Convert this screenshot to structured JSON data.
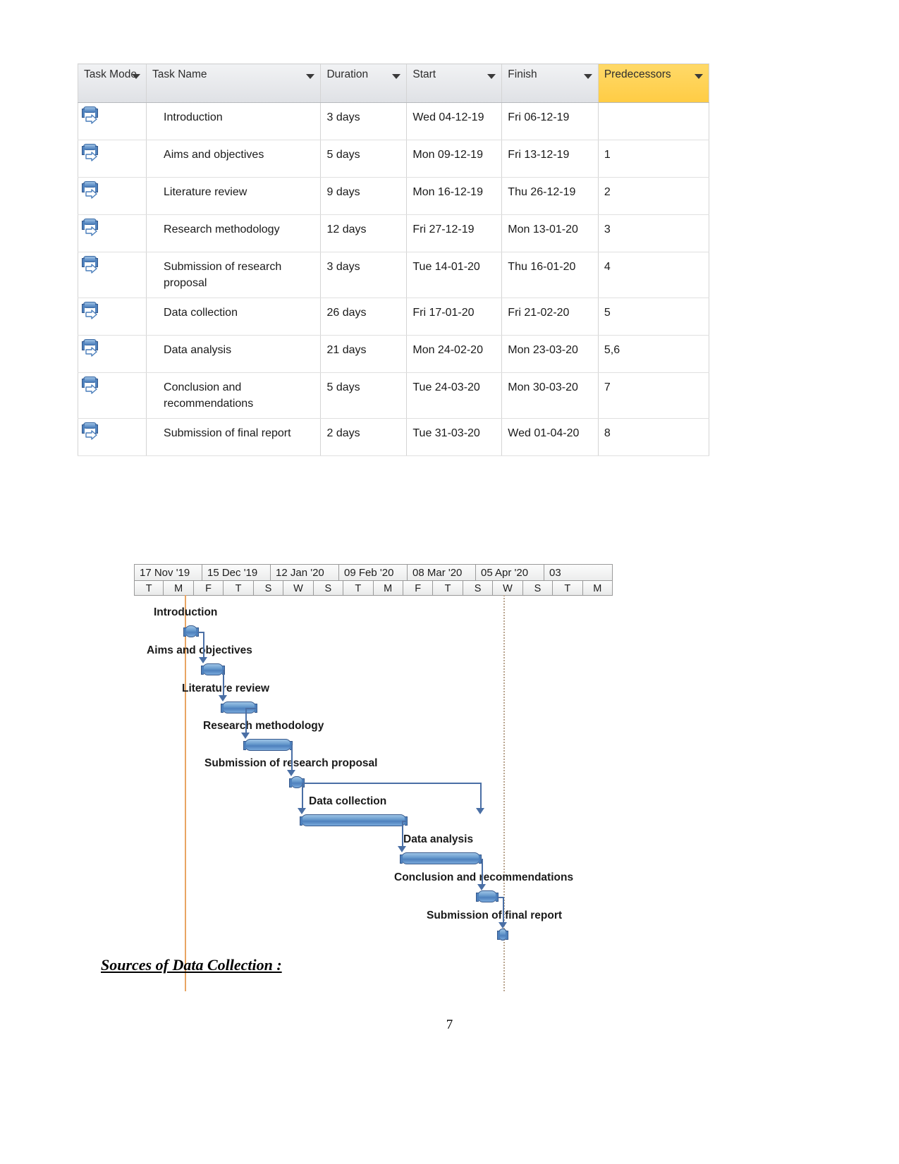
{
  "table": {
    "columns": [
      {
        "key": "mode",
        "label": "Task Mode"
      },
      {
        "key": "name",
        "label": "Task Name"
      },
      {
        "key": "duration",
        "label": "Duration"
      },
      {
        "key": "start",
        "label": "Start"
      },
      {
        "key": "finish",
        "label": "Finish"
      },
      {
        "key": "predecessors",
        "label": "Predecessors"
      }
    ],
    "header_highlight_color": "#ffcc44",
    "rows": [
      {
        "mode_icon": "auto-schedule-icon",
        "name": "Introduction",
        "duration": "3 days",
        "start": "Wed 04-12-19",
        "finish": "Fri 06-12-19",
        "predecessors": ""
      },
      {
        "mode_icon": "auto-schedule-icon",
        "name": "Aims and objectives",
        "duration": "5 days",
        "start": "Mon 09-12-19",
        "finish": "Fri 13-12-19",
        "predecessors": "1"
      },
      {
        "mode_icon": "auto-schedule-icon",
        "name": "Literature review",
        "duration": "9 days",
        "start": "Mon 16-12-19",
        "finish": "Thu 26-12-19",
        "predecessors": "2"
      },
      {
        "mode_icon": "auto-schedule-icon",
        "name": "Research methodology",
        "duration": "12 days",
        "start": "Fri 27-12-19",
        "finish": "Mon 13-01-20",
        "predecessors": "3"
      },
      {
        "mode_icon": "auto-schedule-icon",
        "name": "Submission of research proposal",
        "duration": "3 days",
        "start": "Tue 14-01-20",
        "finish": "Thu 16-01-20",
        "predecessors": "4"
      },
      {
        "mode_icon": "auto-schedule-icon",
        "name": "Data collection",
        "duration": "26 days",
        "start": "Fri 17-01-20",
        "finish": "Fri 21-02-20",
        "predecessors": "5"
      },
      {
        "mode_icon": "auto-schedule-icon",
        "name": "Data analysis",
        "duration": "21 days",
        "start": "Mon 24-02-20",
        "finish": "Mon 23-03-20",
        "predecessors": "5,6"
      },
      {
        "mode_icon": "auto-schedule-icon",
        "name": "Conclusion and recommendations",
        "duration": "5 days",
        "start": "Tue 24-03-20",
        "finish": "Mon 30-03-20",
        "predecessors": "7"
      },
      {
        "mode_icon": "auto-schedule-icon",
        "name": "Submission of final report",
        "duration": "2 days",
        "start": "Tue 31-03-20",
        "finish": "Wed 01-04-20",
        "predecessors": "8"
      }
    ]
  },
  "chart_data": {
    "type": "bar",
    "title": "",
    "xlabel": "",
    "ylabel": "",
    "timeline_months": [
      "17 Nov '19",
      "15 Dec '19",
      "12 Jan '20",
      "09 Feb '20",
      "08 Mar '20",
      "05 Apr '20",
      "03 "
    ],
    "timeline_days": [
      "T",
      "M",
      "F",
      "T",
      "S",
      "W",
      "S",
      "T",
      "M",
      "F",
      "T",
      "S",
      "W",
      "S",
      "T",
      "M"
    ],
    "categories": [
      "Introduction",
      "Aims and objectives",
      "Literature review",
      "Research methodology",
      "Submission of research proposal",
      "Data collection",
      "Data analysis",
      "Conclusion and recommendations",
      "Submission of final report"
    ],
    "values": [
      3,
      5,
      9,
      12,
      3,
      26,
      21,
      5,
      2
    ],
    "bar_unit": "days",
    "bars": [
      {
        "label": "Introduction",
        "start": "Wed 04-12-19",
        "finish": "Fri 06-12-19",
        "duration_days": 3,
        "predecessors": ""
      },
      {
        "label": "Aims and objectives",
        "start": "Mon 09-12-19",
        "finish": "Fri 13-12-19",
        "duration_days": 5,
        "predecessors": "1"
      },
      {
        "label": "Literature review",
        "start": "Mon 16-12-19",
        "finish": "Thu 26-12-19",
        "duration_days": 9,
        "predecessors": "2"
      },
      {
        "label": "Research methodology",
        "start": "Fri 27-12-19",
        "finish": "Mon 13-01-20",
        "duration_days": 12,
        "predecessors": "3"
      },
      {
        "label": "Submission of research proposal",
        "start": "Tue 14-01-20",
        "finish": "Thu 16-01-20",
        "duration_days": 3,
        "predecessors": "4"
      },
      {
        "label": "Data collection",
        "start": "Fri 17-01-20",
        "finish": "Fri 21-02-20",
        "duration_days": 26,
        "predecessors": "5"
      },
      {
        "label": "Data analysis",
        "start": "Mon 24-02-20",
        "finish": "Mon 23-03-20",
        "duration_days": 21,
        "predecessors": "5,6"
      },
      {
        "label": "Conclusion and recommendations",
        "start": "Tue 24-03-20",
        "finish": "Mon 30-03-20",
        "duration_days": 5,
        "predecessors": "7"
      },
      {
        "label": "Submission of final report",
        "start": "Tue 31-03-20",
        "finish": "Wed 01-04-20",
        "duration_days": 2,
        "predecessors": "8"
      }
    ],
    "bar_color": "#4e81bd",
    "link_color": "#4a6fa5",
    "today_line_color": "#e8a563",
    "status_line_color": "#b9a48e",
    "grid": false,
    "legend": "none"
  },
  "footer": {
    "sources_heading": "Sources of Data Collection :",
    "page_number": "7"
  }
}
